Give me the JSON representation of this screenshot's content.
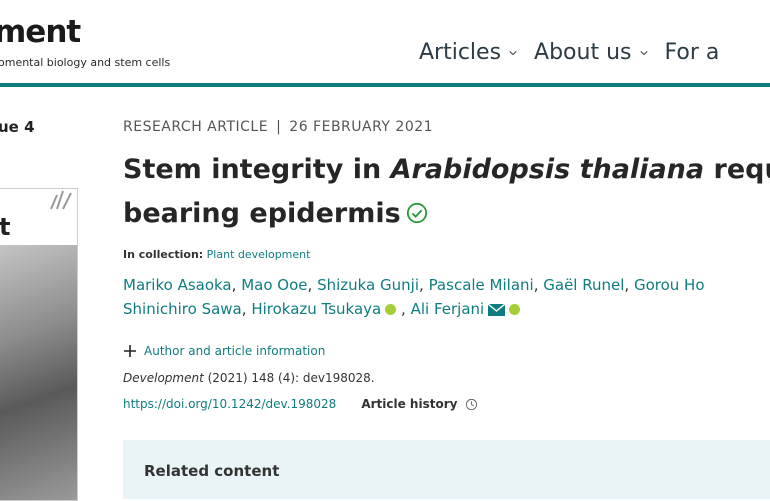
{
  "header": {
    "logo_word": "ment",
    "logo_tagline": "omental biology and stem cells",
    "nav": [
      {
        "label": "Articles"
      },
      {
        "label": "About us"
      },
      {
        "label": "For a"
      }
    ],
    "accent_color": "#0f7d80"
  },
  "sidebar": {
    "issue_label": "ue 4",
    "cover_letter": "t"
  },
  "article": {
    "type": "RESEARCH ARTICLE",
    "separator": "|",
    "date": "26 FEBRUARY 2021",
    "title_part1": "Stem integrity in ",
    "title_italic": "Arabidopsis thaliana",
    "title_part2": " requi",
    "title_line2": "bearing epidermis",
    "verified_icon": "check-circle-icon",
    "collection_label": "In collection:",
    "collection_value": "Plant development",
    "authors_line1": [
      "Mariko Asaoka",
      "Mao Ooe",
      "Shizuka Gunji",
      "Pascale Milani",
      "Gaël Runel",
      "Gorou Ho"
    ],
    "authors_line2": [
      "Shinichiro Sawa",
      "Hirokazu Tsukaya",
      "Ali Ferjani"
    ],
    "comma": ",",
    "author_info_label": "Author and article information",
    "citation_journal": "Development",
    "citation_rest": " (2021) 148 (4): dev198028.",
    "doi": "https://doi.org/10.1242/dev.198028",
    "history_label": "Article history"
  },
  "related": {
    "title": "Related content"
  }
}
